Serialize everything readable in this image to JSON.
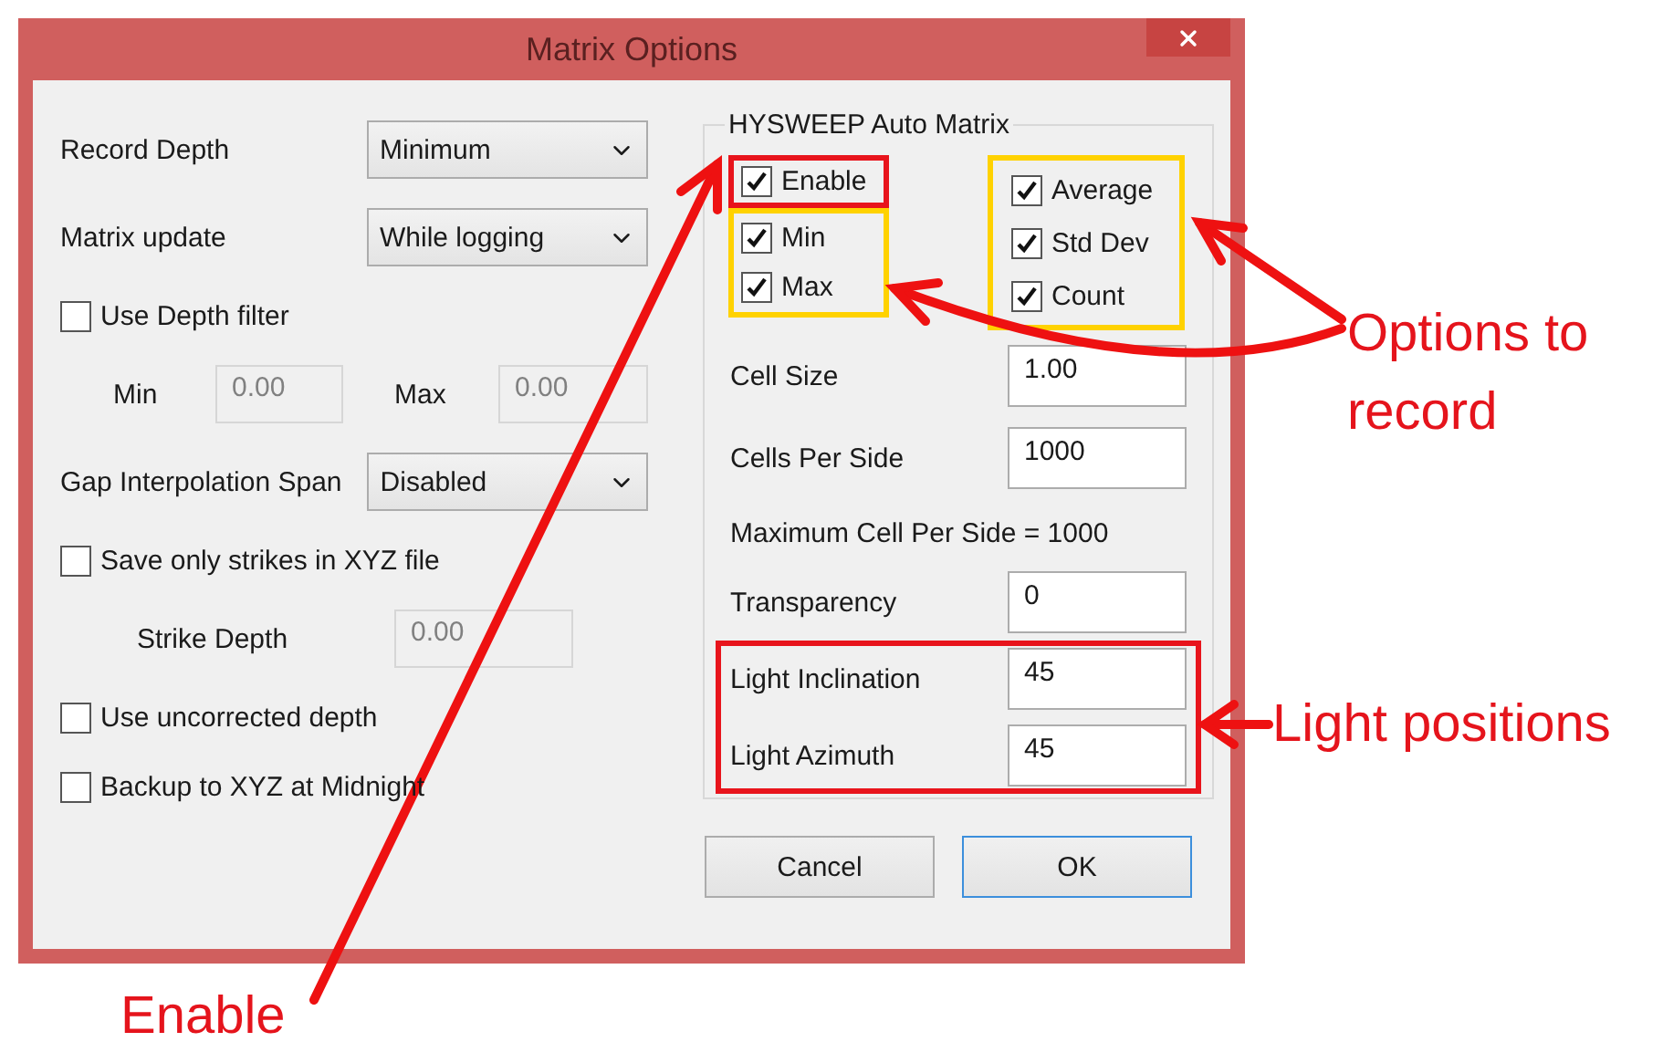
{
  "window": {
    "title": "Matrix Options"
  },
  "left_panel": {
    "rows": [
      {
        "kind": "select",
        "label": "Record Depth",
        "value": "Minimum"
      },
      {
        "kind": "select",
        "label": "Matrix update",
        "value": "While logging"
      },
      {
        "kind": "checkbox",
        "label": "Use Depth filter",
        "checked": false
      },
      {
        "kind": "range",
        "min_label": "Min",
        "min_value": "0.00",
        "max_label": "Max",
        "max_value": "0.00",
        "disabled": true
      },
      {
        "kind": "select",
        "label": "Gap Interpolation Span",
        "value": "Disabled"
      },
      {
        "kind": "checkbox",
        "label": "Save only strikes in XYZ file",
        "checked": false
      },
      {
        "kind": "field",
        "label": "Strike Depth",
        "value": "0.00",
        "disabled": true
      },
      {
        "kind": "checkbox",
        "label": "Use uncorrected depth",
        "checked": false
      },
      {
        "kind": "checkbox",
        "label": "Backup to XYZ at Midnight",
        "checked": false
      }
    ]
  },
  "auto_matrix": {
    "title": "HYSWEEP Auto Matrix",
    "enable": {
      "label": "Enable",
      "checked": true
    },
    "stats_left": [
      {
        "label": "Min",
        "checked": true
      },
      {
        "label": "Max",
        "checked": true
      }
    ],
    "stats_right": [
      {
        "label": "Average",
        "checked": true
      },
      {
        "label": "Std Dev",
        "checked": true
      },
      {
        "label": "Count",
        "checked": true
      }
    ],
    "fields": [
      {
        "label": "Cell Size",
        "value": "1.00"
      },
      {
        "label": "Cells Per Side",
        "value": "1000"
      }
    ],
    "note": "Maximum Cell Per Side = 1000",
    "transparency": {
      "label": "Transparency",
      "value": "0"
    },
    "light_fields": [
      {
        "label": "Light Inclination",
        "value": "45"
      },
      {
        "label": "Light Azimuth",
        "value": "45"
      }
    ]
  },
  "buttons": [
    {
      "label": "Cancel",
      "default": false
    },
    {
      "label": "OK",
      "default": true
    }
  ],
  "callouts": {
    "options": "Options to record",
    "light": "Light positions",
    "enable": "Enable"
  }
}
